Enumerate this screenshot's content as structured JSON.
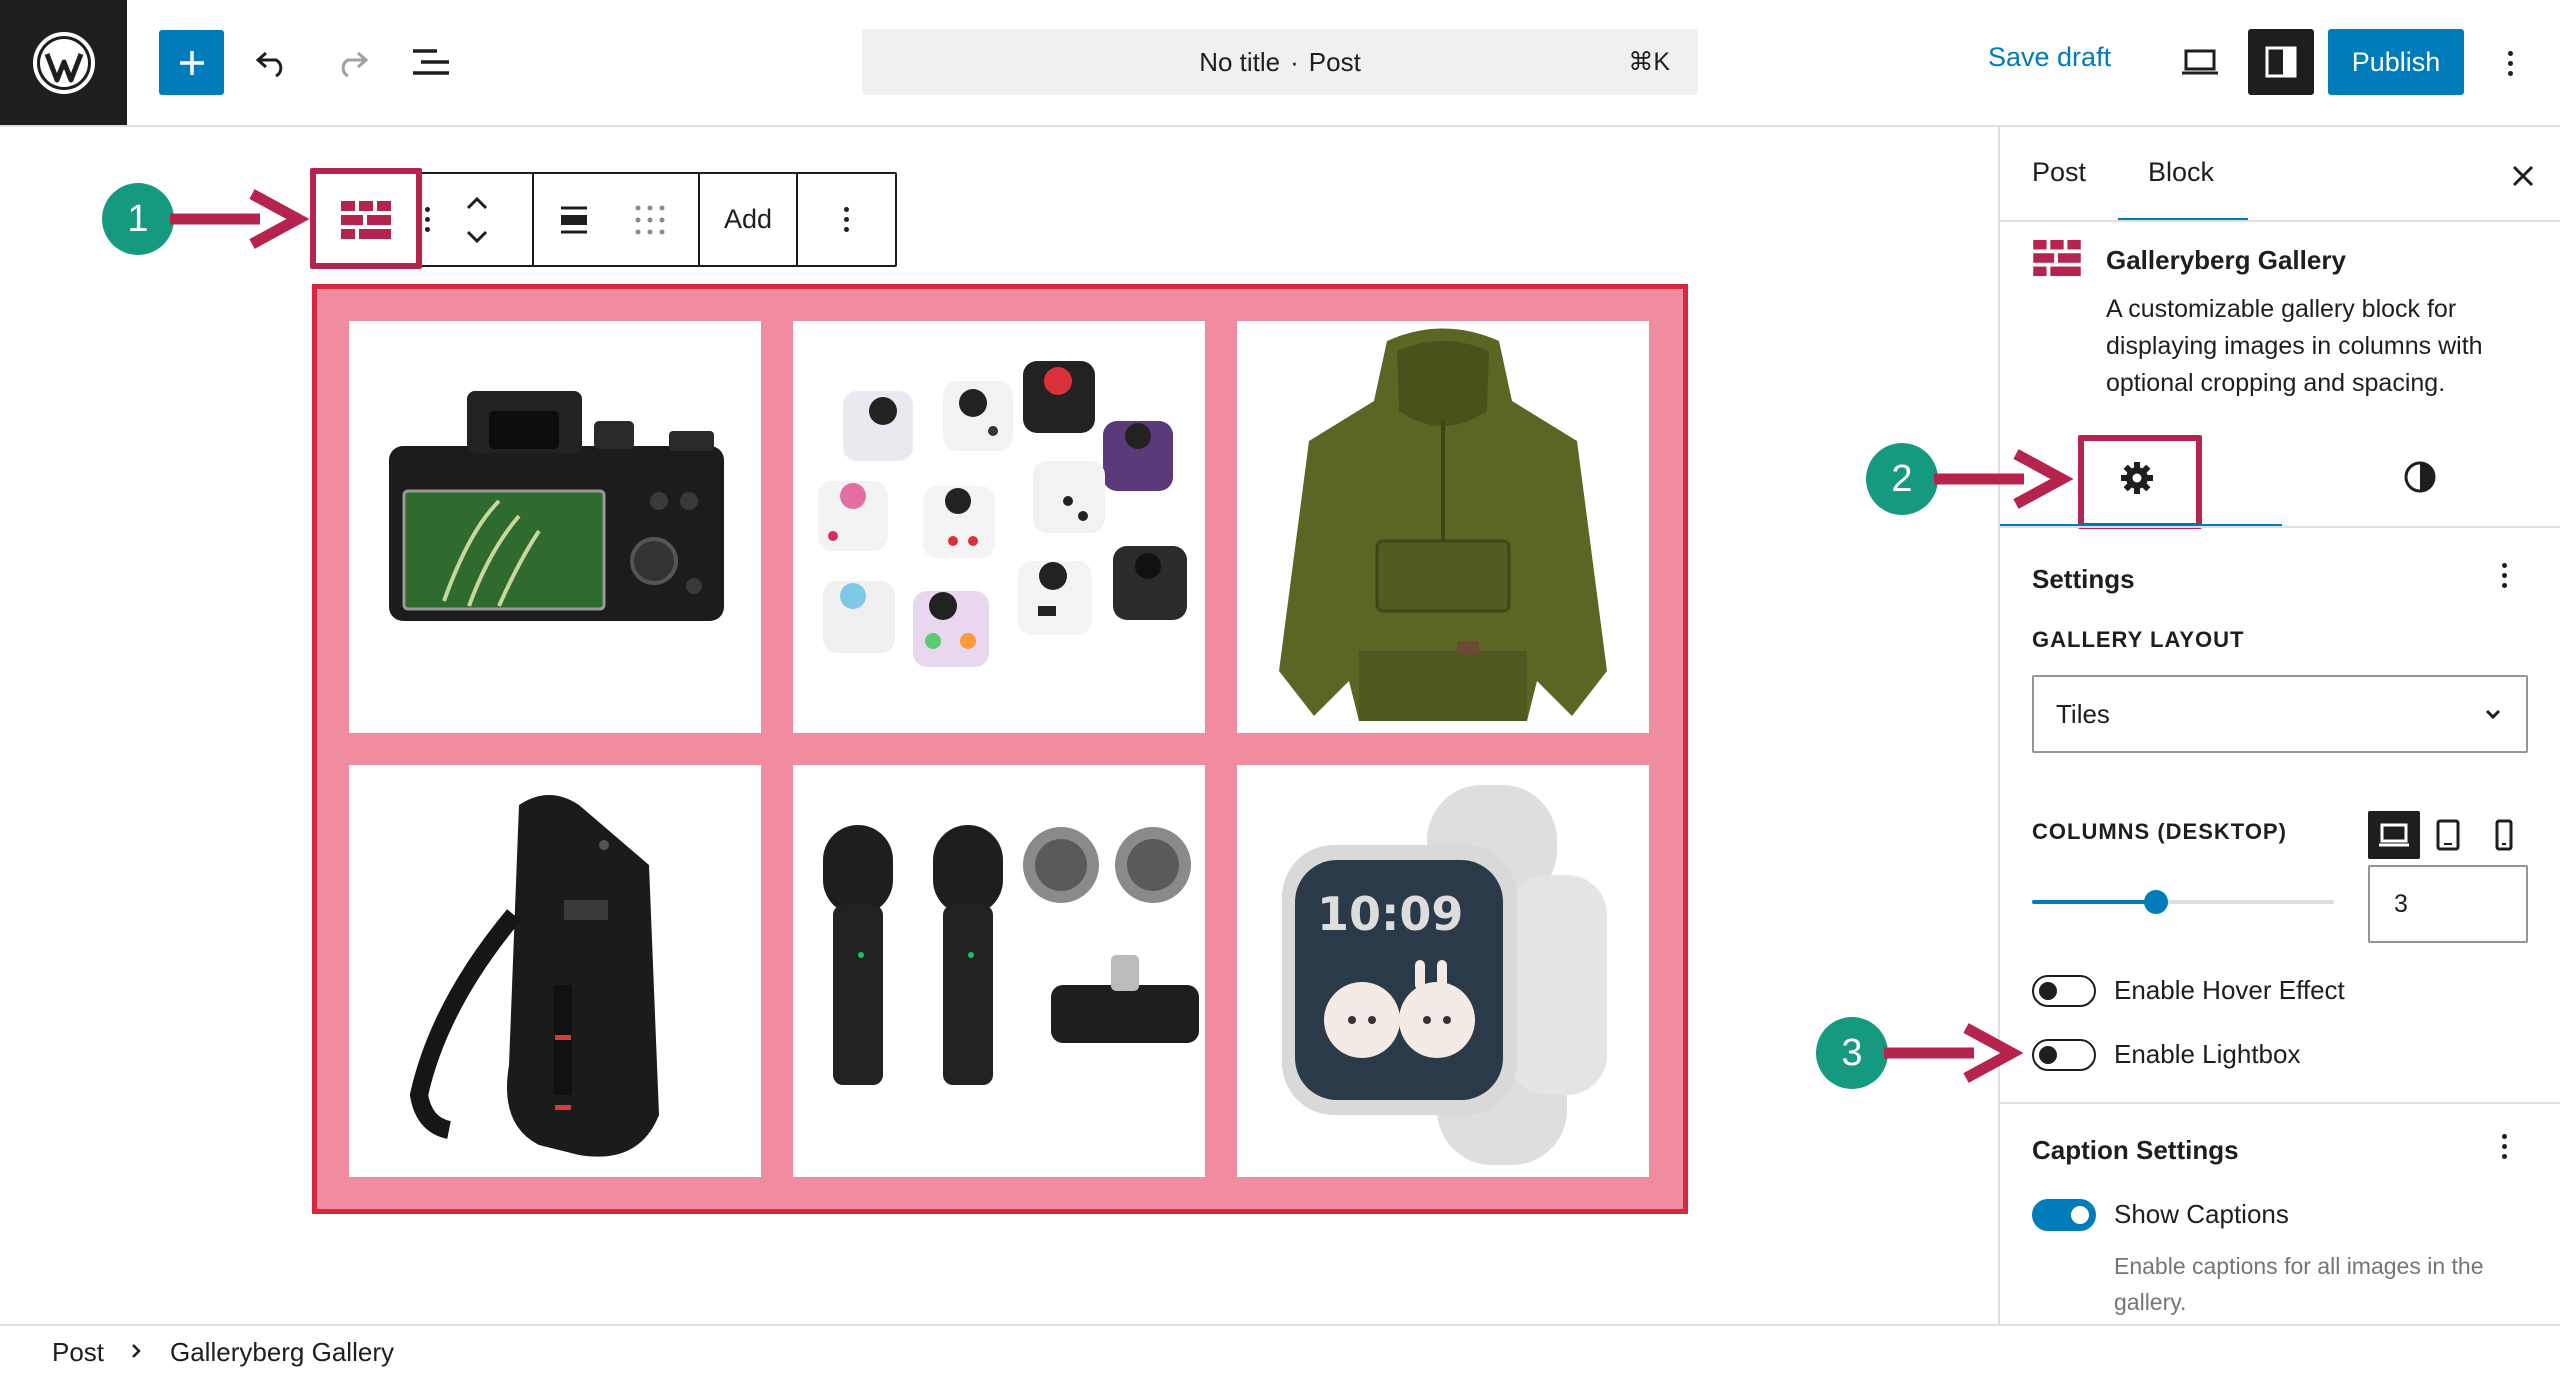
{
  "header": {
    "doc_title": "No title",
    "doc_separator": "·",
    "doc_type": "Post",
    "shortcut": "⌘K",
    "save_draft_label": "Save draft",
    "publish_label": "Publish",
    "icons": [
      "wordpress-logo",
      "plus-icon",
      "undo-icon",
      "redo-icon",
      "list-view-icon",
      "laptop-preview-icon",
      "sidebar-toggle-icon",
      "more-vertical-icon"
    ]
  },
  "block_toolbar": {
    "add_label": "Add",
    "icons": [
      "gallery-block-icon",
      "drag-handle-icon",
      "move-up-icon",
      "move-down-icon",
      "align-icon",
      "grid-dots-icon",
      "more-vertical-icon"
    ]
  },
  "gallery": {
    "images": [
      "camera",
      "fidget-cubes",
      "green-hoodie",
      "sling-bag",
      "wireless-microphones",
      "smartwatch"
    ]
  },
  "annotations": [
    "1",
    "2",
    "3"
  ],
  "sidebar": {
    "tabs": [
      {
        "label": "Post"
      },
      {
        "label": "Block"
      }
    ],
    "active_tab": "Block",
    "block_title": "Galleryberg Gallery",
    "block_description": "A customizable gallery block for displaying images in columns with optional cropping and spacing.",
    "settings": {
      "title": "Settings",
      "layout_label": "GALLERY LAYOUT",
      "layout_value": "Tiles",
      "columns_label": "COLUMNS (DESKTOP)",
      "columns_value": "3",
      "columns_slider_fraction": 0.41,
      "hover_label": "Enable Hover Effect",
      "hover_on": false,
      "lightbox_label": "Enable Lightbox",
      "lightbox_on": false
    },
    "caption_settings": {
      "title": "Caption Settings",
      "show_captions_label": "Show Captions",
      "show_captions_on": true,
      "help": "Enable captions for all images in the gallery."
    }
  },
  "breadcrumb": [
    {
      "label": "Post"
    },
    {
      "label": "Galleryberg Gallery"
    }
  ],
  "colors": {
    "accent": "#007cba",
    "highlight": "#b5244c",
    "badge": "#159a80",
    "gallery_bg": "#f08ba0",
    "gallery_border": "#d7263d"
  }
}
